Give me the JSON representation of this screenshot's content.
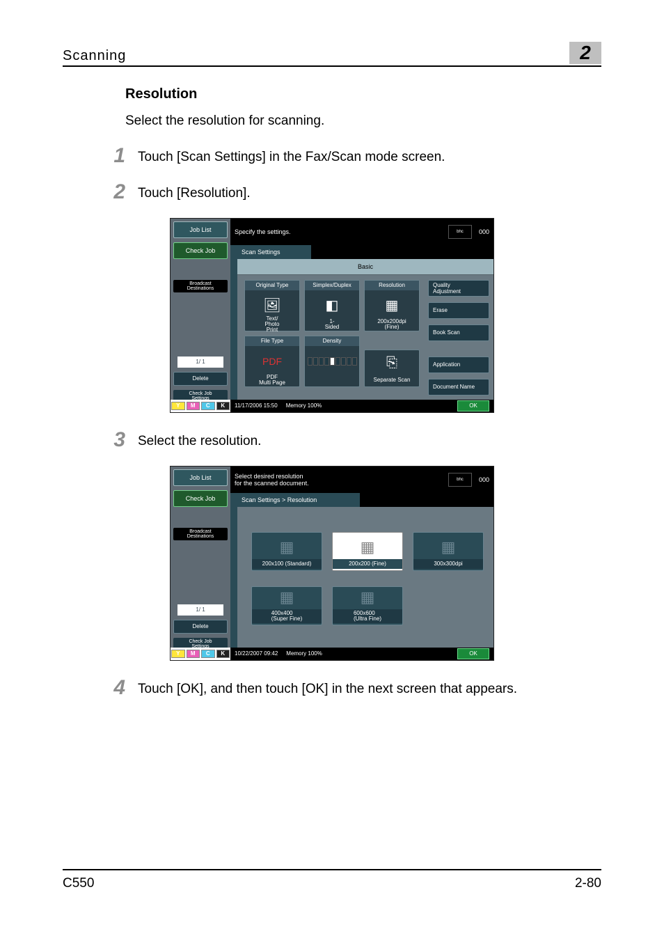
{
  "header": {
    "section": "Scanning",
    "chapter": "2"
  },
  "section_title": "Resolution",
  "intro": "Select the resolution for scanning.",
  "steps": [
    {
      "n": "1",
      "t": "Touch [Scan Settings] in the Fax/Scan mode screen."
    },
    {
      "n": "2",
      "t": "Touch [Resolution]."
    },
    {
      "n": "3",
      "t": "Select the resolution."
    },
    {
      "n": "4",
      "t": "Touch [OK], and then touch [OK] in the next screen that appears."
    }
  ],
  "footer": {
    "model": "C550",
    "page": "2-80"
  },
  "shot1": {
    "prompt": "Specify the settings.",
    "logo": "bhc",
    "count": "000",
    "side": {
      "job_list": "Job List",
      "check_job": "Check Job",
      "bd": "Broadcast\nDestinations",
      "page": "1/  1",
      "delete": "Delete",
      "cjs": "Check Job\nSettings"
    },
    "ymck": [
      "Y",
      "M",
      "C",
      "K"
    ],
    "tab": "Scan Settings",
    "basic": "Basic",
    "cells": {
      "orig": {
        "label": "Original Type",
        "sub": "Text/\nPhoto\nPrint"
      },
      "simp": {
        "label": "Simplex/Duplex",
        "sub": "1-\nSided"
      },
      "res": {
        "label": "Resolution",
        "sub": "200x200dpi\n(Fine)"
      },
      "file": {
        "label": "File Type",
        "sub": "PDF\nMulti Page"
      },
      "dens": {
        "label": "Density"
      },
      "sep": {
        "sub": "Separate Scan"
      }
    },
    "right": [
      "Quality\nAdjustment",
      "Erase",
      "Book Scan",
      "Application",
      "Document Name"
    ],
    "datetime": "11/17/2006   15:50",
    "memory": "Memory      100%",
    "ok": "OK"
  },
  "shot2": {
    "prompt": "Select desired resolution\nfor the scanned document.",
    "logo": "bhc",
    "count": "000",
    "tab": "Scan Settings > Resolution",
    "side": {
      "job_list": "Job List",
      "check_job": "Check Job",
      "bd": "Broadcast\nDestinations",
      "page": "1/  1",
      "delete": "Delete",
      "cjs": "Check Job\nSettings"
    },
    "ymck": [
      "Y",
      "M",
      "C",
      "K"
    ],
    "res": [
      {
        "l": "200x100 (Standard)",
        "sel": false
      },
      {
        "l": "200x200 (Fine)",
        "sel": true
      },
      {
        "l": "300x300dpi",
        "sel": false
      },
      {
        "l": "400x400\n(Super Fine)",
        "sel": false
      },
      {
        "l": "600x600\n(Ultra Fine)",
        "sel": false
      }
    ],
    "datetime": "10/22/2007   09:42",
    "memory": "Memory      100%",
    "ok": "OK"
  }
}
